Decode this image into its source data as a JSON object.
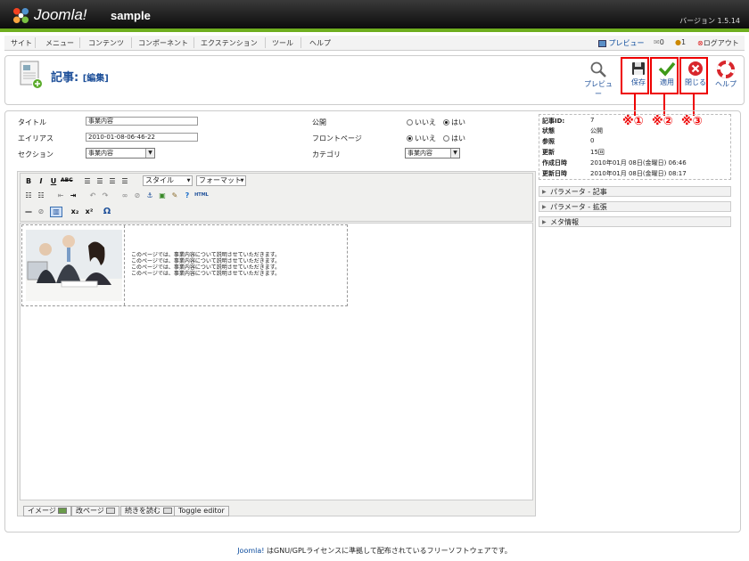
{
  "header": {
    "brand": "Joomla!",
    "site_name": "sample",
    "version": "バージョン 1.5.14"
  },
  "menu": {
    "items": [
      "サイト",
      "メニュー",
      "コンテンツ",
      "コンポーネント",
      "エクステンション",
      "ツール",
      "ヘルプ"
    ]
  },
  "status": {
    "preview": "プレビュー",
    "messages": "0",
    "users": "1",
    "logout": "ログアウト"
  },
  "page": {
    "title": "記事:",
    "subtitle": "[編集]"
  },
  "toolbar": {
    "preview": "プレビュー",
    "save": "保存",
    "apply": "適用",
    "close": "閉じる",
    "help": "ヘルプ"
  },
  "markers": [
    "※①",
    "※②",
    "※③"
  ],
  "form": {
    "title_label": "タイトル",
    "title_value": "事業内容",
    "alias_label": "エイリアス",
    "alias_value": "2010-01-08-06-46-22",
    "section_label": "セクション",
    "section_value": "事業内容",
    "published_label": "公開",
    "frontpage_label": "フロントページ",
    "category_label": "カテゴリ",
    "category_value": "事業内容",
    "no": "いいえ",
    "yes": "はい"
  },
  "info": {
    "labels": [
      "記事ID:",
      "状態",
      "参照",
      "更新",
      "作成日時",
      "更新日時"
    ],
    "values": [
      "7",
      "公開",
      "0",
      "15回",
      "2010年01月 08日(金曜日) 06:46",
      "2010年01月 08日(金曜日) 08:17"
    ]
  },
  "panels": [
    "パラメータ - 記事",
    "パラメータ - 拡張",
    "メタ情報"
  ],
  "editor": {
    "style_select": "スタイル",
    "format_select": "フォーマット",
    "content_lines": [
      "このページでは、事業内容について説明させていただきます。",
      "このページでは、事業内容について説明させていただきます。",
      "このページでは、事業内容について説明させていただきます。",
      "このページでは、事業内容について説明させていただきます。"
    ],
    "buttons": [
      "イメージ",
      "改ページ",
      "続きを読む",
      "Toggle editor"
    ]
  },
  "footer": {
    "link": "Joomla!",
    "text": " はGNU/GPLライセンスに準拠して配布されているフリーソフトウェアです。"
  },
  "colors": {
    "accent_green": "#6fae1f",
    "link_blue": "#1d4f99",
    "annotation_red": "#ee0000"
  }
}
